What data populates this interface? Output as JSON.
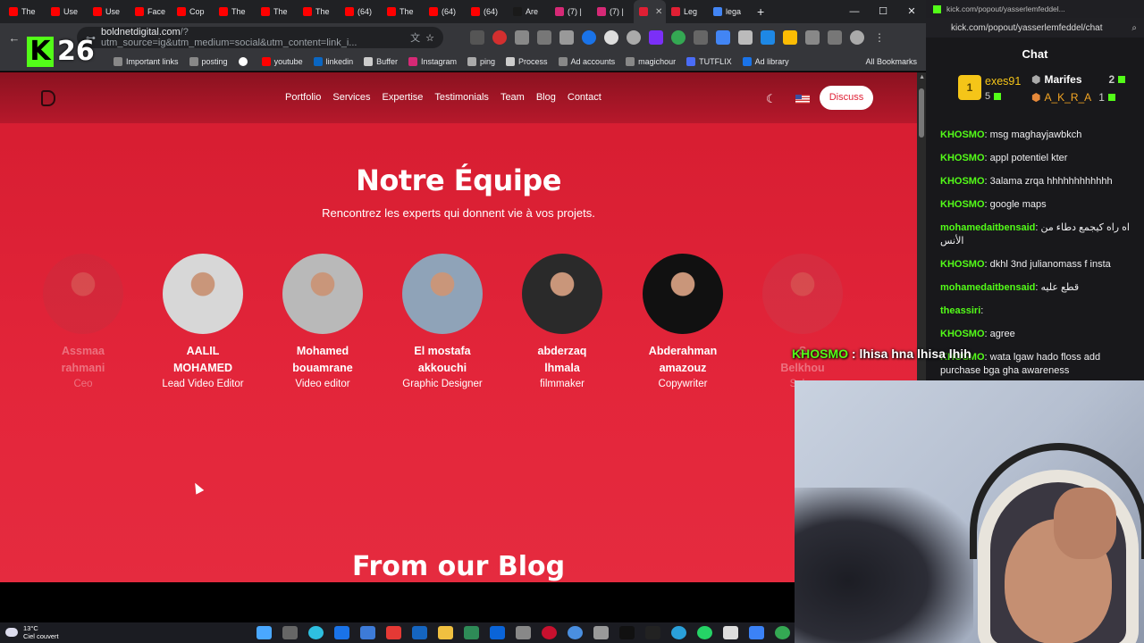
{
  "browser": {
    "tabs": [
      {
        "label": "The",
        "color": "#ff0000"
      },
      {
        "label": "Use",
        "color": "#ff0000"
      },
      {
        "label": "Use",
        "color": "#ff0000"
      },
      {
        "label": "Face",
        "color": "#ff0000"
      },
      {
        "label": "Cop",
        "color": "#ff0000"
      },
      {
        "label": "The",
        "color": "#ff0000"
      },
      {
        "label": "The",
        "color": "#ff0000"
      },
      {
        "label": "The",
        "color": "#ff0000"
      },
      {
        "label": "(64)",
        "color": "#ff0000"
      },
      {
        "label": "The",
        "color": "#ff0000"
      },
      {
        "label": "(64)",
        "color": "#ff0000"
      },
      {
        "label": "(64)",
        "color": "#ff0000"
      },
      {
        "label": "Are",
        "color": "#1a1a1a"
      },
      {
        "label": "(7) |",
        "color": "#d62976"
      },
      {
        "label": "(7) |",
        "color": "#d62976"
      },
      {
        "label": "",
        "color": "#e01f34"
      },
      {
        "label": "Leg",
        "color": "#e01f34"
      },
      {
        "label": "lega",
        "color": "#4285f4"
      }
    ],
    "url_host": "boldnetdigital.com",
    "url_rest": "/?utm_source=ig&utm_medium=social&utm_content=link_i...",
    "bookmarks": [
      "Important links",
      "posting",
      "",
      "youtube",
      "linkedin",
      "Buffer",
      "Instagram",
      "ping",
      "Process",
      "Ad accounts",
      "magichour",
      "TUTFLIX",
      "Ad library"
    ],
    "all_bookmarks": "All Bookmarks"
  },
  "kick_badge": {
    "logo": "K",
    "number": "26"
  },
  "site": {
    "nav": [
      "Portfolio",
      "Services",
      "Expertise",
      "Testimonials",
      "Team",
      "Blog",
      "Contact"
    ],
    "cta": "Discuss",
    "team_title": "Notre Équipe",
    "team_subtitle": "Rencontrez les experts qui donnent vie à vos projets.",
    "members": [
      {
        "name1": "Assmaa",
        "name2": "rahmani",
        "role": "Ceo",
        "bg": "#c0303f"
      },
      {
        "name1": "AALIL",
        "name2": "MOHAMED",
        "role": "Lead Video Editor",
        "bg": "#d7d7d7"
      },
      {
        "name1": "Mohamed",
        "name2": "bouamrane",
        "role": "Video editor",
        "bg": "#b9b9b9"
      },
      {
        "name1": "El mostafa",
        "name2": "akkouchi",
        "role": "Graphic Designer",
        "bg": "#8fa3b8"
      },
      {
        "name1": "abderzaq",
        "name2": "lhmala",
        "role": "filmmaker",
        "bg": "#2a2a2a"
      },
      {
        "name1": "Abderahman",
        "name2": "amazouz",
        "role": "Copywriter",
        "bg": "#111111"
      },
      {
        "name1": "S",
        "name2": "Belkhou",
        "role": "Sales",
        "bg": "#c84050"
      }
    ],
    "blog_title": "From our Blog"
  },
  "chat": {
    "popout_url": "kick.com/popout/yasserlemfeddel...",
    "address": "kick.com/popout/yasserlemfeddel/chat",
    "title": "Chat",
    "leaderboard": [
      {
        "rank": "1",
        "user": "exes91",
        "count": "5"
      },
      {
        "rank": "",
        "user": "Marifes",
        "count": "2"
      },
      {
        "rank": "",
        "user": "A_K_R_A",
        "count": "1"
      }
    ],
    "messages": [
      {
        "user": "KHOSMO",
        "text": "msg maghayjawbkch"
      },
      {
        "user": "KHOSMO",
        "text": "appl potentiel kter"
      },
      {
        "user": "KHOSMO",
        "text": "3alama zrqa hhhhhhhhhhhh"
      },
      {
        "user": "KHOSMO",
        "text": "google maps"
      },
      {
        "user": "mohamedaitbensaid",
        "text": "اه راه كيجمع دطاء من الأنس"
      },
      {
        "user": "KHOSMO",
        "text": "dkhl 3nd julianomass f insta"
      },
      {
        "user": "mohamedaitbensaid",
        "text": "قطع عليه"
      },
      {
        "user": "theassiri",
        "text": ""
      },
      {
        "user": "KHOSMO",
        "text": "agree"
      },
      {
        "user": "KHOSMO",
        "text": "wata lgaw hado floss add purchase bga gha awareness"
      }
    ],
    "overlay": {
      "user": "KHOSMO",
      "text": " : lhisa hna lhisa lhih"
    }
  },
  "taskbar": {
    "temp": "13°C",
    "condition": "Ciel couvert"
  }
}
